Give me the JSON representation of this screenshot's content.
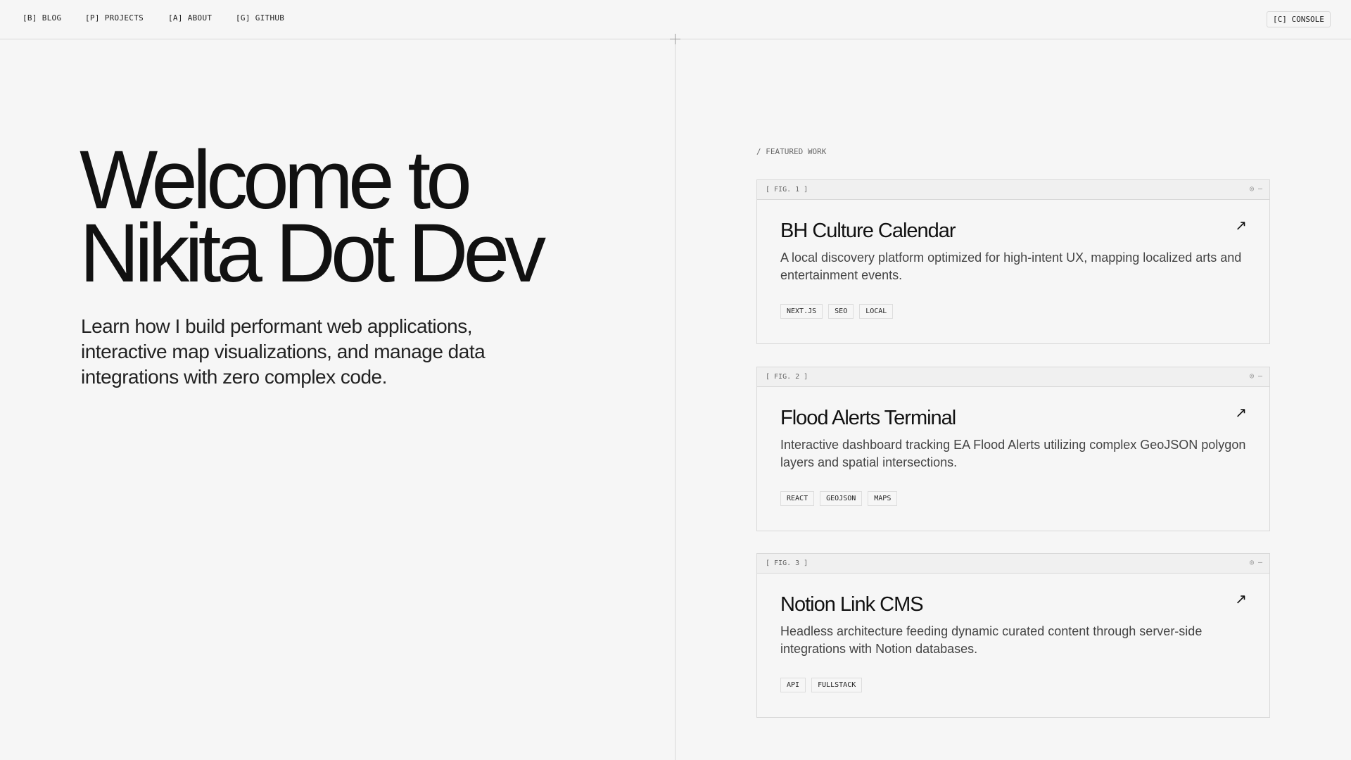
{
  "nav": {
    "items": [
      "[B] BLOG",
      "[P] PROJECTS",
      "[A] ABOUT",
      "[G] GITHUB"
    ],
    "console": "[C] CONSOLE"
  },
  "hero": {
    "line1": "Welcome to",
    "line2": "Nikita Dot Dev",
    "subtitle": "Learn how I build performant web applications, interactive map visualizations, and manage data integrations with zero complex code."
  },
  "featured": {
    "label": "/ FEATURED WORK",
    "cards": [
      {
        "fig": "[ FIG. 1 ]",
        "controls": "◎ —",
        "title": "BH Culture Calendar",
        "arrow": "↗",
        "description": "A local discovery platform optimized for high-intent UX, mapping localized arts and entertainment events.",
        "tags": [
          "NEXT.JS",
          "SEO",
          "LOCAL"
        ]
      },
      {
        "fig": "[ FIG. 2 ]",
        "controls": "◎ —",
        "title": "Flood Alerts Terminal",
        "arrow": "↗",
        "description": "Interactive dashboard tracking EA Flood Alerts utilizing complex GeoJSON polygon layers and spatial intersections.",
        "tags": [
          "REACT",
          "GEOJSON",
          "MAPS"
        ]
      },
      {
        "fig": "[ FIG. 3 ]",
        "controls": "◎ —",
        "title": "Notion Link CMS",
        "arrow": "↗",
        "description": "Headless architecture feeding dynamic curated content through server-side integrations with Notion databases.",
        "tags": [
          "API",
          "FULLSTACK"
        ]
      }
    ]
  }
}
